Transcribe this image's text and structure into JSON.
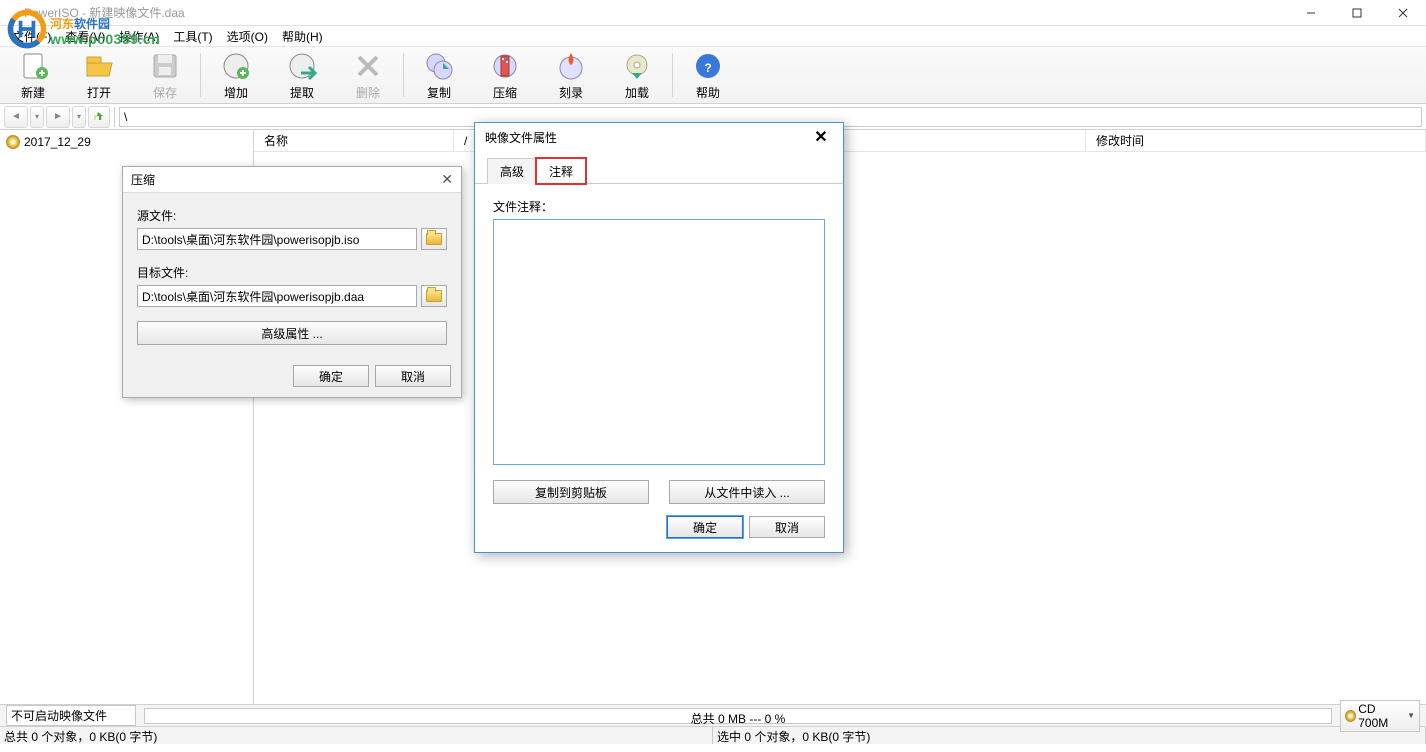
{
  "window": {
    "title": "PowerISO - 新建映像文件.daa"
  },
  "menubar": {
    "file": "文件(F)",
    "view": "查看(V)",
    "action": "操作(A)",
    "tools": "工具(T)",
    "options": "选项(O)",
    "help": "帮助(H)"
  },
  "toolbar": {
    "new": "新建",
    "open": "打开",
    "save": "保存",
    "add": "增加",
    "extract": "提取",
    "delete": "删除",
    "copy": "复制",
    "compress": "压缩",
    "burn": "刻录",
    "mount": "加载",
    "help": "帮助"
  },
  "nav": {
    "path": "\\"
  },
  "tree": {
    "root": "2017_12_29"
  },
  "list": {
    "col_name": "名称",
    "col_slash": "/",
    "col_modified": "修改时间"
  },
  "compress_dialog": {
    "title": "压缩",
    "source_label": "源文件:",
    "source_value": "D:\\tools\\桌面\\河东软件园\\powerisopjb.iso",
    "target_label": "目标文件:",
    "target_value": "D:\\tools\\桌面\\河东软件园\\powerisopjb.daa",
    "advanced": "高级属性 ...",
    "ok": "确定",
    "cancel": "取消"
  },
  "props_dialog": {
    "title": "映像文件属性",
    "tab_advanced": "高级",
    "tab_comment": "注释",
    "comment_label": "文件注释：",
    "copy_clip": "复制到剪贴板",
    "load_file": "从文件中读入 ...",
    "ok": "确定",
    "cancel": "取消"
  },
  "status": {
    "boot": "不可启动映像文件",
    "progress": "总共  0 MB  ---  0 %",
    "disc": "CD 700M",
    "total": "总共 0 个对象，0 KB(0 字节)",
    "selected": "选中 0 个对象，0 KB(0 字节)"
  },
  "watermark": {
    "text1_orange": "河东",
    "text1_blue": "软件园",
    "url": "www.pc0359.cn"
  }
}
